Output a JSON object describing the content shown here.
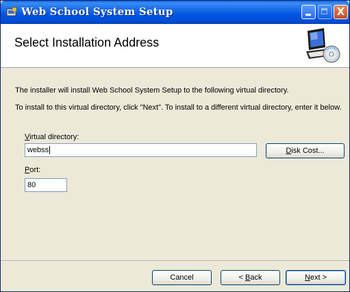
{
  "window": {
    "title": "Web School System Setup",
    "close_glyph": "X"
  },
  "banner": {
    "heading": "Select Installation Address",
    "graphic_icon": "computer-cd-icon"
  },
  "body": {
    "line1": "The installer will install Web School System Setup to the following virtual directory.",
    "line2": "To install to this virtual directory, click \"Next\". To install to a different virtual directory, enter it below."
  },
  "fields": {
    "virtual_directory": {
      "label_mnemonic": "V",
      "label_rest": "irtual directory:",
      "value": "webss"
    },
    "port": {
      "label_mnemonic": "P",
      "label_rest": "ort:",
      "value": "80"
    }
  },
  "buttons": {
    "disk_cost": {
      "mnemonic": "D",
      "rest": "isk Cost..."
    },
    "cancel": {
      "label": "Cancel"
    },
    "back": {
      "prefix": "< ",
      "mnemonic": "B",
      "rest": "ack"
    },
    "next": {
      "mnemonic": "N",
      "rest": "ext >"
    }
  },
  "colors": {
    "titlebar": "#0054e3",
    "dialog_bg": "#ece9d8",
    "banner_bg": "#ffffff"
  }
}
